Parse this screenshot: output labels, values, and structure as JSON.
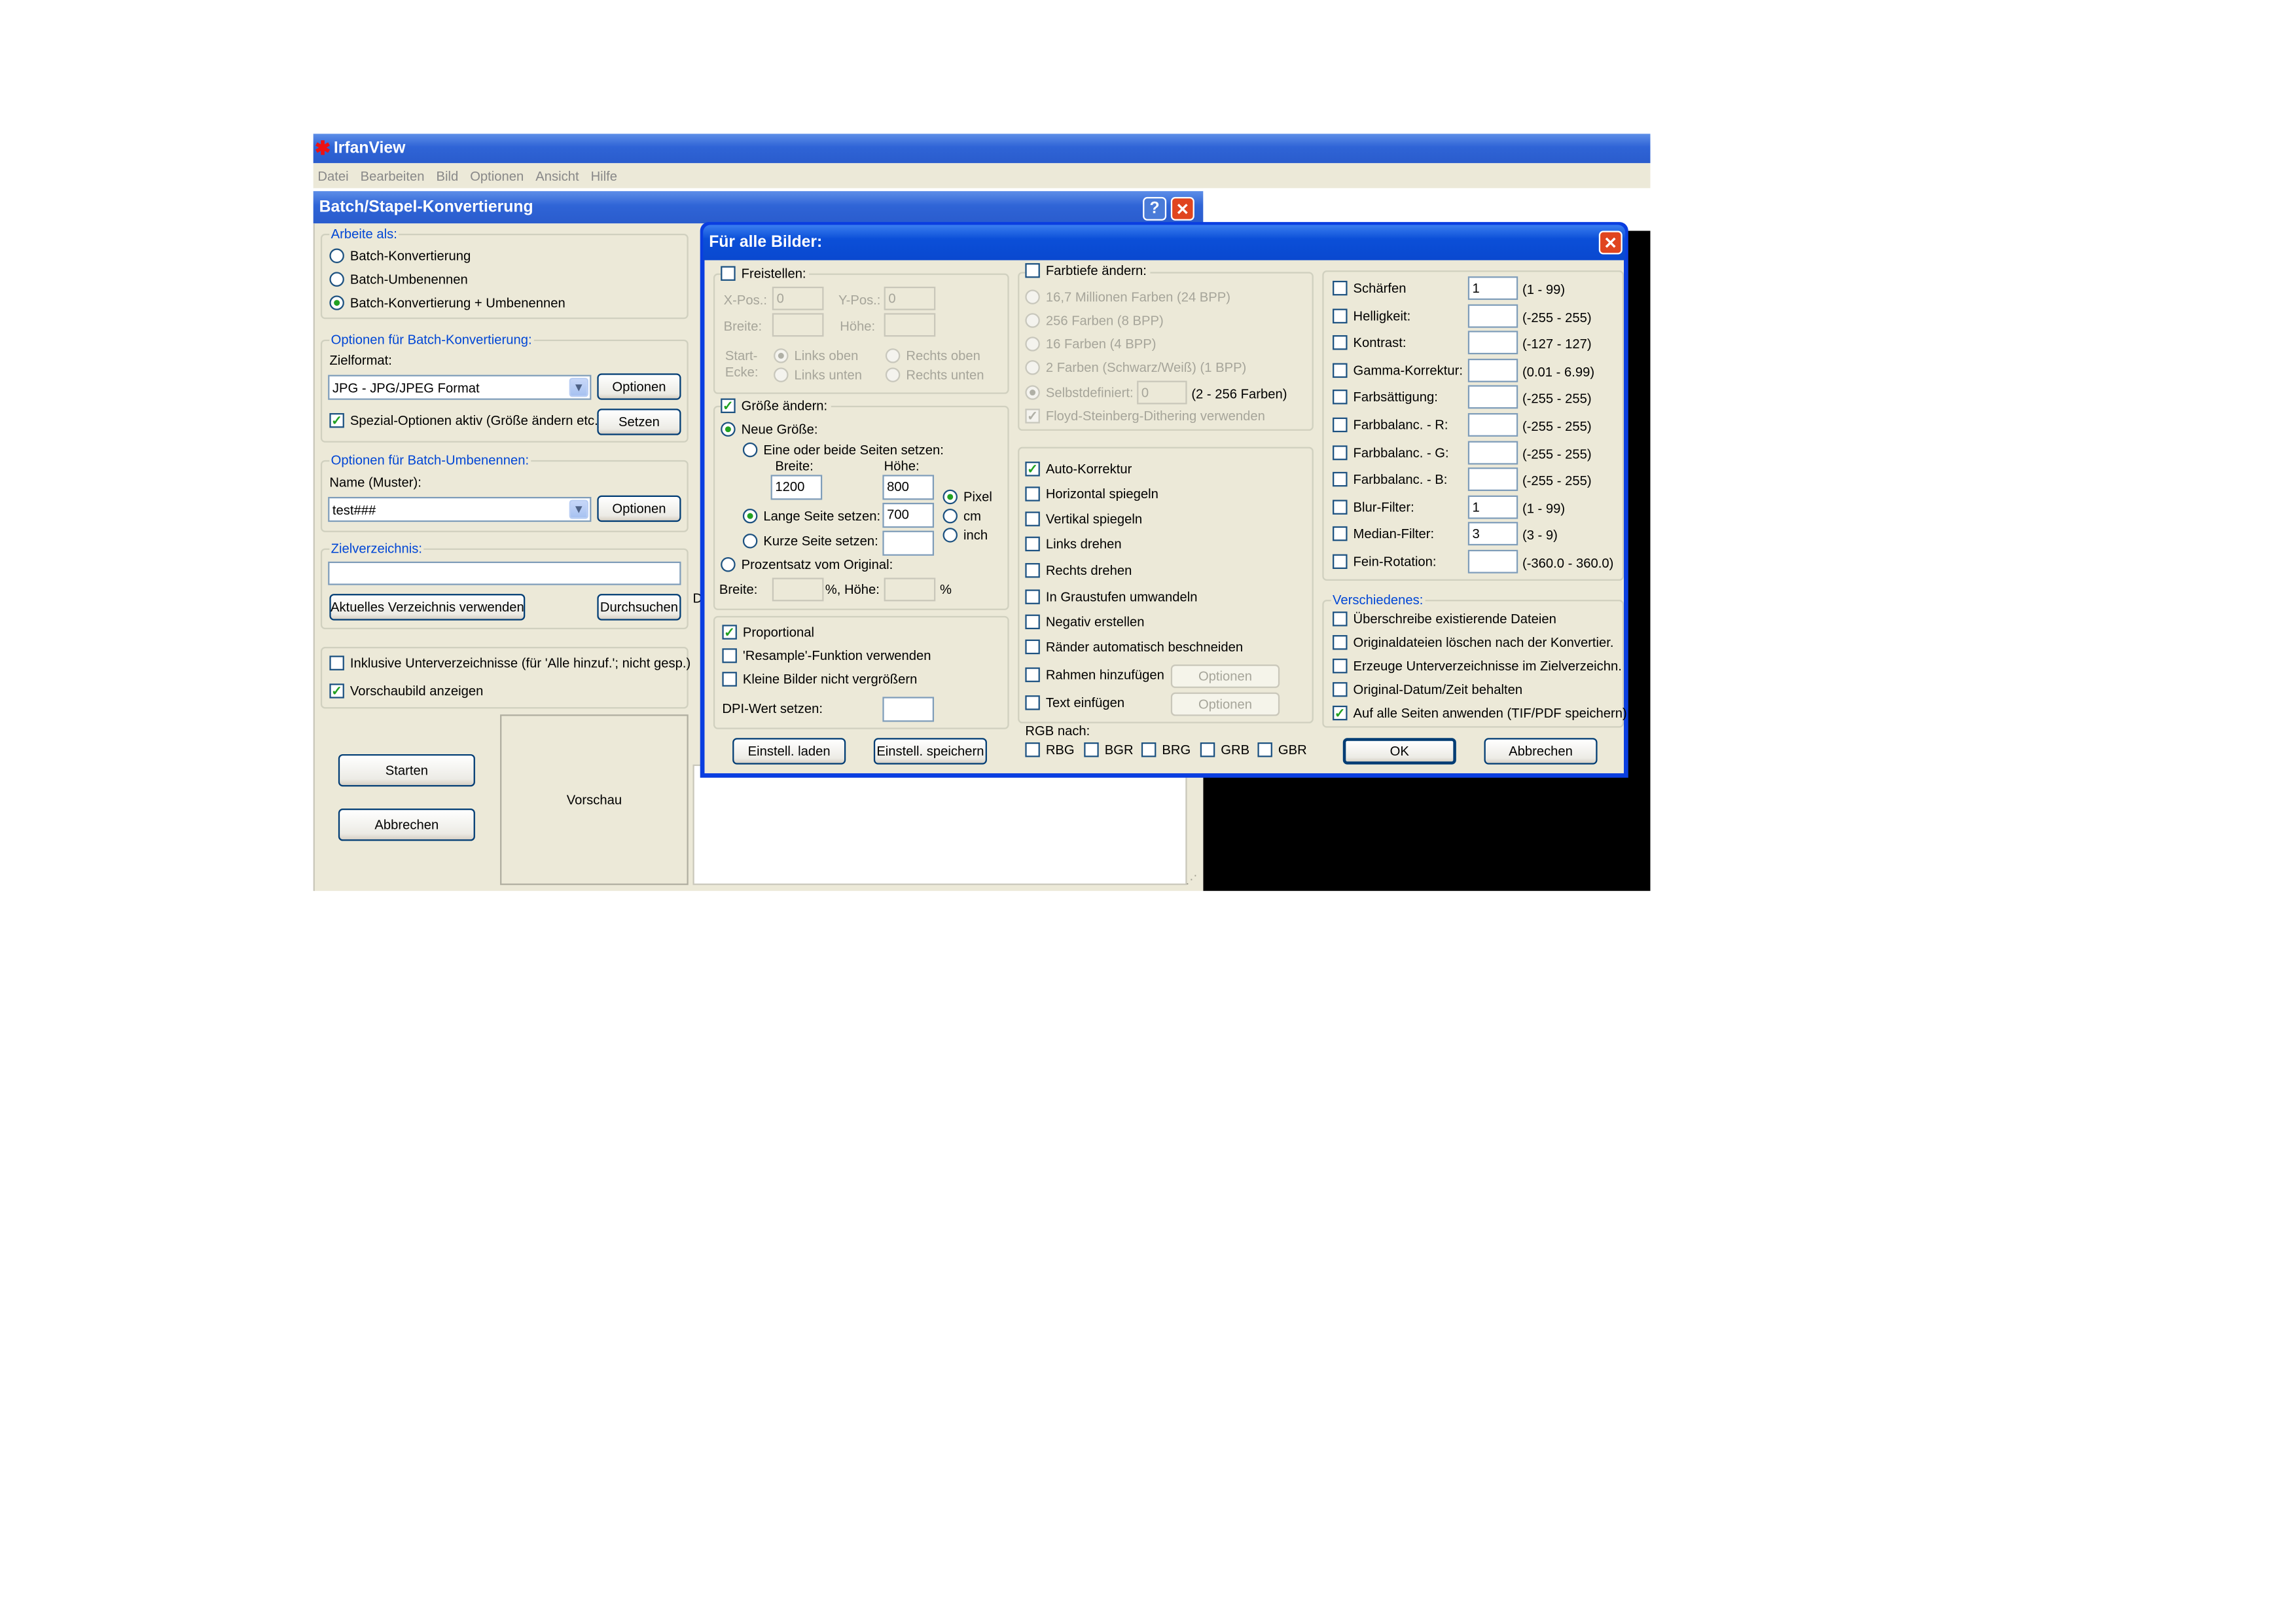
{
  "app": {
    "title": "IrfanView",
    "menu": [
      "Datei",
      "Bearbeiten",
      "Bild",
      "Optionen",
      "Ansicht",
      "Hilfe"
    ]
  },
  "batch": {
    "title": "Batch/Stapel-Konvertierung",
    "help_btn": "?",
    "arbeite_als": "Arbeite als:",
    "modes": [
      "Batch-Konvertierung",
      "Batch-Umbenennen",
      "Batch-Konvertierung + Umbenennen"
    ],
    "konv_group": "Optionen für Batch-Konvertierung:",
    "zielformat_label": "Zielformat:",
    "zielformat_value": "JPG - JPG/JPEG Format",
    "optionen_btn": "Optionen",
    "spezial_label": "Spezial-Optionen aktiv (Größe ändern etc.)",
    "setzen_btn": "Setzen",
    "umben_group": "Optionen für Batch-Umbenennen:",
    "name_label": "Name (Muster):",
    "name_value": "test###",
    "optionen_btn2": "Optionen",
    "zielverz_label": "Zielverzeichnis:",
    "aktuelles_btn": "Aktuelles Verzeichnis verwenden",
    "durchsuchen_btn": "Durchsuchen",
    "inkl_unterverz": "Inklusive Unterverzeichnisse (für 'Alle hinzuf.'; nicht gesp.)",
    "vorschaubild": "Vorschaubild anzeigen",
    "starten_btn": "Starten",
    "abbrechen_btn": "Abbrechen",
    "vorschau": "Vorschau",
    "partial_d": "D"
  },
  "dialog": {
    "title": "Für alle Bilder:",
    "freistellen": "Freistellen:",
    "xpos_label": "X-Pos.:",
    "xpos_value": "0",
    "ypos_label": "Y-Pos.:",
    "ypos_value": "0",
    "breite_label": "Breite:",
    "hoehe_label": "Höhe:",
    "start_label": "Start-",
    "ecke_label": "Ecke:",
    "links_oben": "Links oben",
    "rechts_oben": "Rechts oben",
    "links_unten": "Links unten",
    "rechts_unten": "Rechts unten",
    "groesse_aendern": "Größe ändern:",
    "neue_groesse": "Neue Größe:",
    "eine_oder_beide": "Eine oder beide Seiten setzen:",
    "breite_col": "Breite:",
    "hoehe_col": "Höhe:",
    "breite_value": "1200",
    "hoehe_value": "800",
    "lange_seite": "Lange Seite setzen:",
    "lange_value": "700",
    "kurze_seite": "Kurze Seite setzen:",
    "units": [
      "Pixel",
      "cm",
      "inch"
    ],
    "prozentsatz": "Prozentsatz vom Original:",
    "breite_pct_label": "Breite:",
    "pct_sign": "%,",
    "hoehe_pct_label": "Höhe:",
    "pct_sign2": "%",
    "proportional": "Proportional",
    "resample": "'Resample'-Funktion verwenden",
    "kleine_bilder": "Kleine Bilder nicht vergrößern",
    "dpi_label": "DPI-Wert setzen:",
    "einstell_laden": "Einstell. laden",
    "einstell_speichern": "Einstell. speichern",
    "farbtiefe": "Farbtiefe ändern:",
    "farbtiefe_opts": [
      "16,7 Millionen Farben (24 BPP)",
      "256 Farben (8 BPP)",
      "16 Farben (4 BPP)",
      "2 Farben (Schwarz/Weiß) (1 BPP)"
    ],
    "selbstdefiniert": "Selbstdefiniert:",
    "selbst_value": "0",
    "selbst_range": "(2 - 256 Farben)",
    "floyd": "Floyd-Steinberg-Dithering verwenden",
    "mid_checks": [
      "Auto-Korrektur",
      "Horizontal spiegeln",
      "Vertikal spiegeln",
      "Links drehen",
      "Rechts drehen",
      "In Graustufen umwandeln",
      "Negativ erstellen",
      "Ränder automatisch beschneiden",
      "Rahmen hinzufügen",
      "Text einfügen"
    ],
    "optionen": "Optionen",
    "rgb_nach": "RGB nach:",
    "rgb_opts": [
      "RBG",
      "BGR",
      "BRG",
      "GRB",
      "GBR"
    ],
    "right_checks": [
      {
        "label": "Schärfen",
        "value": "1",
        "range": "(1 - 99)"
      },
      {
        "label": "Helligkeit:",
        "value": "",
        "range": "(-255 - 255)"
      },
      {
        "label": "Kontrast:",
        "value": "",
        "range": "(-127 - 127)"
      },
      {
        "label": "Gamma-Korrektur:",
        "value": "",
        "range": "(0.01 - 6.99)"
      },
      {
        "label": "Farbsättigung:",
        "value": "",
        "range": "(-255 - 255)"
      },
      {
        "label": "Farbbalanc. - R:",
        "value": "",
        "range": "(-255 - 255)"
      },
      {
        "label": "Farbbalanc. - G:",
        "value": "",
        "range": "(-255 - 255)"
      },
      {
        "label": "Farbbalanc. - B:",
        "value": "",
        "range": "(-255 - 255)"
      },
      {
        "label": "Blur-Filter:",
        "value": "1",
        "range": "(1 - 99)"
      },
      {
        "label": "Median-Filter:",
        "value": "3",
        "range": "(3 - 9)"
      },
      {
        "label": "Fein-Rotation:",
        "value": "",
        "range": "(-360.0 - 360.0)"
      }
    ],
    "verschiedenes": "Verschiedenes:",
    "versch_checks": [
      "Überschreibe existierende Dateien",
      "Originaldateien löschen nach der Konvertier.",
      "Erzeuge Unterverzeichnisse im Zielverzeichn.",
      "Original-Datum/Zeit behalten",
      "Auf alle Seiten anwenden (TIF/PDF speichern)"
    ],
    "ok_btn": "OK",
    "abbrechen_btn": "Abbrechen"
  },
  "colors": {
    "xp_title_blue": "#2a5ccd",
    "dialog_bg": "#ece9d8",
    "group_label": "#0046d5",
    "check_green": "#21a121",
    "close_red": "#e0451f"
  }
}
